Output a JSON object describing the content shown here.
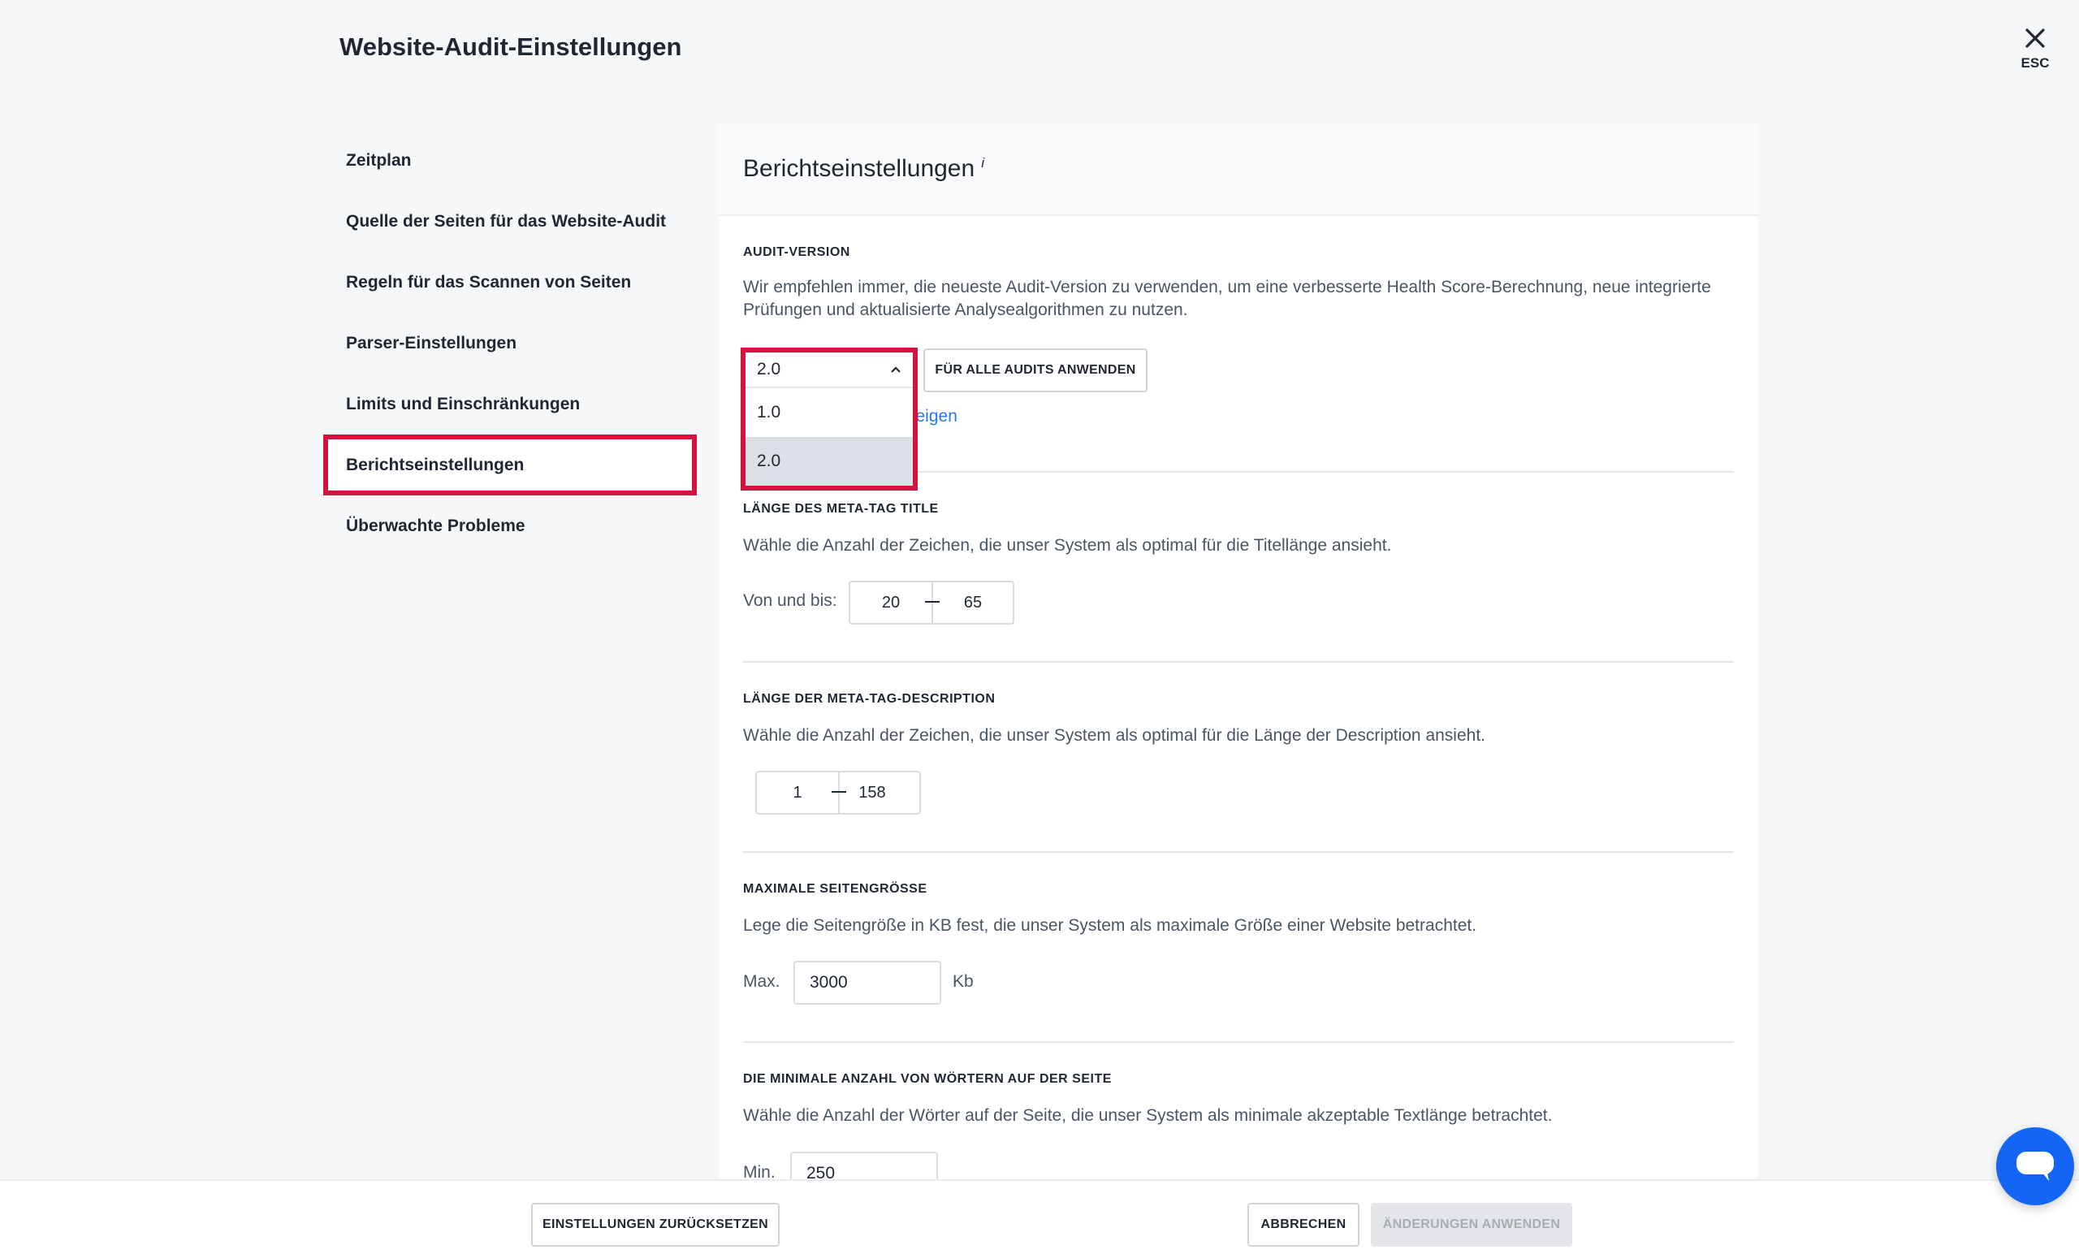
{
  "modal": {
    "title": "Website-Audit-Einstellungen",
    "close_label": "ESC"
  },
  "sidebar": {
    "items": [
      {
        "label": "Zeitplan"
      },
      {
        "label": "Quelle der Seiten für das Website-Audit"
      },
      {
        "label": "Regeln für das Scannen von Seiten"
      },
      {
        "label": "Parser-Einstellungen"
      },
      {
        "label": "Limits und Einschränkungen"
      },
      {
        "label": "Berichtseinstellungen",
        "active": true
      },
      {
        "label": "Überwachte Probleme"
      }
    ]
  },
  "panel": {
    "title": "Berichtseinstellungen",
    "info_mark": "i",
    "audit_version": {
      "label": "AUDIT-VERSION",
      "description": "Wir empfehlen immer, die neueste Audit-Version zu verwenden, um eine verbesserte Health Score-Berechnung, neue integrierte Prüfungen und aktualisierte Analysealgorithmen zu nutzen.",
      "selected": "2.0",
      "options": [
        "1.0",
        "2.0"
      ],
      "apply_all_button": "FÜR ALLE AUDITS ANWENDEN",
      "partial_link": "zeigen"
    },
    "title_length": {
      "label": "LÄNGE DES META-TAG TITLE",
      "description": "Wähle die Anzahl der Zeichen, die unser System als optimal für die Titellänge ansieht.",
      "range_label": "Von und bis:",
      "from": "20",
      "to": "65"
    },
    "description_length": {
      "label": "LÄNGE DER META-TAG-DESCRIPTION",
      "description": "Wähle die Anzahl der Zeichen, die unser System als optimal für die Länge der Description ansieht.",
      "from": "1",
      "to": "158"
    },
    "max_page_size": {
      "label": "MAXIMALE SEITENGRÖSSE",
      "description": "Lege die Seitengröße in KB fest, die unser System als maximale Größe einer Website betrachtet.",
      "prefix": "Max.",
      "value": "3000",
      "unit": "Kb"
    },
    "min_words": {
      "label": "DIE MINIMALE ANZAHL VON WÖRTERN AUF DER SEITE",
      "description": "Wähle die Anzahl der Wörter auf der Seite, die unser System als minimale akzeptable Textlänge betrachtet.",
      "prefix": "Min.",
      "value": "250"
    }
  },
  "footer": {
    "reset_button": "EINSTELLUNGEN ZURÜCKSETZEN",
    "cancel_button": "ABBRECHEN",
    "apply_button": "ÄNDERUNGEN ANWENDEN"
  },
  "colors": {
    "highlight": "#d4123e",
    "chat": "#1565f5",
    "link": "#2b77d9"
  }
}
